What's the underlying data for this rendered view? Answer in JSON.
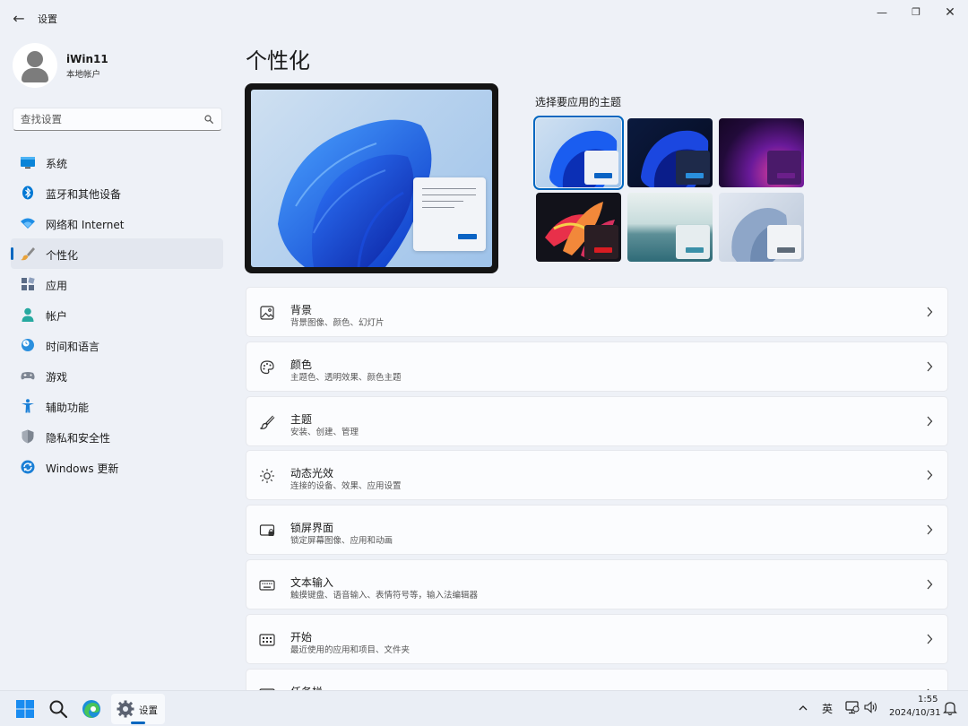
{
  "window": {
    "title": "设置",
    "back_glyph": "←",
    "minimize_glyph": "—",
    "maximize_glyph": "❐",
    "close_glyph": "✕"
  },
  "profile": {
    "name": "iWin11",
    "account_type": "本地帐户"
  },
  "search": {
    "placeholder": "查找设置"
  },
  "sidebar": {
    "items": [
      {
        "label": "系统",
        "icon": "monitor-icon"
      },
      {
        "label": "蓝牙和其他设备",
        "icon": "bluetooth-icon"
      },
      {
        "label": "网络和 Internet",
        "icon": "wifi-icon"
      },
      {
        "label": "个性化",
        "icon": "brush-icon",
        "active": true
      },
      {
        "label": "应用",
        "icon": "apps-icon"
      },
      {
        "label": "帐户",
        "icon": "person-icon"
      },
      {
        "label": "时间和语言",
        "icon": "clock-globe-icon"
      },
      {
        "label": "游戏",
        "icon": "gamepad-icon"
      },
      {
        "label": "辅助功能",
        "icon": "accessibility-icon"
      },
      {
        "label": "隐私和安全性",
        "icon": "shield-icon"
      },
      {
        "label": "Windows 更新",
        "icon": "update-icon"
      }
    ]
  },
  "main": {
    "title": "个性化",
    "themes_label": "选择要应用的主题",
    "themes": [
      {
        "name": "theme-windows-light",
        "selected": true
      },
      {
        "name": "theme-windows-dark"
      },
      {
        "name": "theme-glow"
      },
      {
        "name": "theme-captured-motion"
      },
      {
        "name": "theme-sunrise"
      },
      {
        "name": "theme-flow"
      }
    ],
    "cards": [
      {
        "title": "背景",
        "subtitle": "背景图像、颜色、幻灯片",
        "icon": "picture-icon"
      },
      {
        "title": "颜色",
        "subtitle": "主题色、透明效果、颜色主题",
        "icon": "palette-icon"
      },
      {
        "title": "主题",
        "subtitle": "安装、创建、管理",
        "icon": "brush-icon"
      },
      {
        "title": "动态光效",
        "subtitle": "连接的设备、效果、应用设置",
        "icon": "sun-icon"
      },
      {
        "title": "锁屏界面",
        "subtitle": "锁定屏幕图像、应用和动画",
        "icon": "lock-screen-icon"
      },
      {
        "title": "文本输入",
        "subtitle": "触摸键盘、语音输入、表情符号等，输入法编辑器",
        "icon": "keyboard-icon"
      },
      {
        "title": "开始",
        "subtitle": "最近使用的应用和项目、文件夹",
        "icon": "start-menu-icon"
      },
      {
        "title": "任务栏",
        "subtitle": "",
        "icon": "taskbar-icon"
      }
    ]
  },
  "taskbar": {
    "settings_label": "设置",
    "ime": "英",
    "time": "1:55",
    "date": "2024/10/31"
  },
  "colors": {
    "accent": "#0067c0",
    "background": "#eef1f7",
    "card": "#fbfcfe"
  }
}
